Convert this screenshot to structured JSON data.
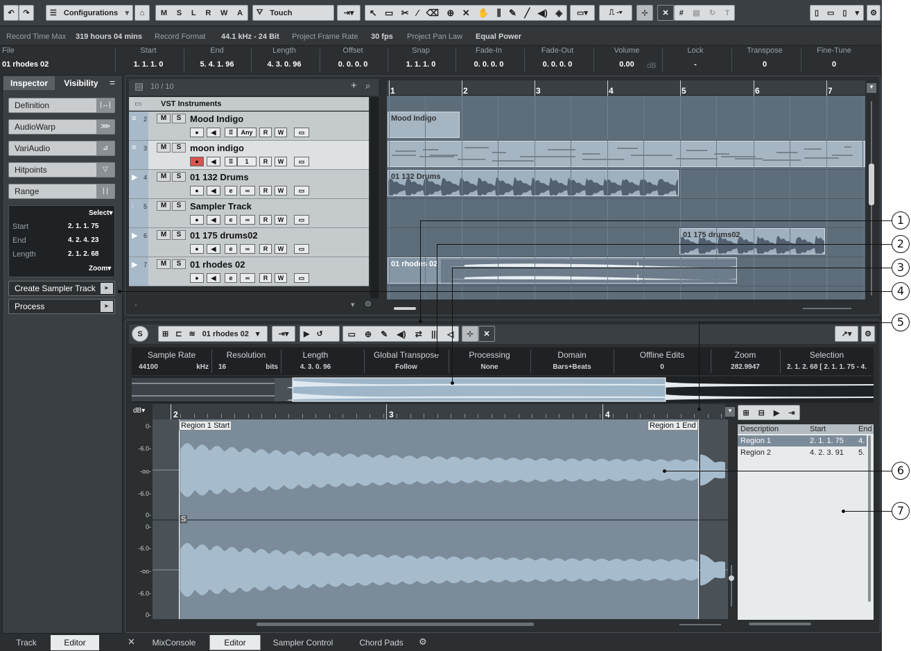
{
  "toolbar": {
    "configurations": "Configurations",
    "automation_mode": "Touch",
    "msrwa": [
      "M",
      "S",
      "L",
      "R",
      "W",
      "A"
    ]
  },
  "status": {
    "record_time_label": "Record Time Max",
    "record_time_value": "319 hours 04 mins",
    "record_format_label": "Record Format",
    "record_format_value": "44.1 kHz - 24 Bit",
    "frame_rate_label": "Project Frame Rate",
    "frame_rate_value": "30 fps",
    "pan_law_label": "Project Pan Law",
    "pan_law_value": "Equal Power"
  },
  "infoline": {
    "file_label": "File",
    "file_value": "01 rhodes 02",
    "cols": [
      {
        "h": "Start",
        "v": "1. 1. 1.   0"
      },
      {
        "h": "End",
        "v": "5. 4. 1. 96"
      },
      {
        "h": "Length",
        "v": "4. 3. 0. 96"
      },
      {
        "h": "Offset",
        "v": "0. 0. 0.   0"
      },
      {
        "h": "Snap",
        "v": "1. 1. 1.   0"
      },
      {
        "h": "Fade-In",
        "v": "0. 0. 0.   0"
      },
      {
        "h": "Fade-Out",
        "v": "0. 0. 0.   0"
      },
      {
        "h": "Volume",
        "v": "0.00"
      },
      {
        "h": "Lock",
        "v": "-"
      },
      {
        "h": "Transpose",
        "v": "0"
      },
      {
        "h": "Fine-Tune",
        "v": "0"
      }
    ],
    "volume_unit": "dB"
  },
  "inspector": {
    "tabs": [
      "Inspector",
      "Visibility"
    ],
    "buttons": [
      "Definition",
      "AudioWarp",
      "VariAudio",
      "Hitpoints",
      "Range"
    ],
    "select_label": "Select",
    "zoom_label": "Zoom",
    "range_rows": [
      {
        "k": "Start",
        "v": "2. 1. 1. 75"
      },
      {
        "k": "End",
        "v": "4. 2. 4. 23"
      },
      {
        "k": "Length",
        "v": "2. 1. 2. 68"
      }
    ],
    "create_sampler": "Create Sampler Track",
    "process": "Process",
    "bottom_tabs": [
      "Track",
      "Editor"
    ]
  },
  "project": {
    "track_count": "10 / 10",
    "folder_name": "VST Instruments",
    "tracks": [
      {
        "num": "2",
        "name": "Mood Indigo",
        "ctl": "Any"
      },
      {
        "num": "3",
        "name": "moon indigo",
        "ctl": "1"
      },
      {
        "num": "4",
        "name": "01 132 Drums"
      },
      {
        "num": "5",
        "name": "Sampler Track"
      },
      {
        "num": "6",
        "name": "01 175 drums02"
      },
      {
        "num": "7",
        "name": "01 rhodes 02"
      }
    ],
    "ruler": [
      "1",
      "2",
      "3",
      "4",
      "5",
      "6",
      "7"
    ],
    "clips": [
      "Mood Indigo",
      "01 132 Drums",
      "01 175 drums02",
      "01 rhodes 02"
    ]
  },
  "editor": {
    "file_select": "01 rhodes 02",
    "info": [
      {
        "h": "Sample Rate",
        "v": "44100",
        "u": "kHz"
      },
      {
        "h": "Resolution",
        "v": "16",
        "u": "bits"
      },
      {
        "h": "Length",
        "v": "4. 3. 0. 96"
      },
      {
        "h": "Global Transpose",
        "v": "Follow"
      },
      {
        "h": "Processing",
        "v": "None"
      },
      {
        "h": "Domain",
        "v": "Bars+Beats"
      },
      {
        "h": "Offline Edits",
        "v": "0"
      },
      {
        "h": "Zoom",
        "v": "282.9947"
      },
      {
        "h": "Selection",
        "v": "2. 1. 2. 68 [ 2. 1. 1. 75 - 4."
      }
    ],
    "ruler": [
      "2",
      "3",
      "4"
    ],
    "db_unit": "dB",
    "db_labels": [
      "0-",
      "-6.0-",
      "-oo-",
      "-6.0-",
      "0-"
    ],
    "region_start": "Region 1 Start",
    "region_end": "Region 1 End",
    "s_marker": "S",
    "regions_header": [
      "Description",
      "Start",
      "End"
    ],
    "regions": [
      {
        "d": "Region 1",
        "s": "2. 1. 1. 75",
        "e": "4."
      },
      {
        "d": "Region 2",
        "s": "4. 2. 3. 91",
        "e": "5."
      }
    ]
  },
  "bottom_tabs": [
    "MixConsole",
    "Editor",
    "Sampler Control",
    "Chord Pads"
  ],
  "callouts": [
    "1",
    "2",
    "3",
    "4",
    "5",
    "6",
    "7"
  ],
  "colors": {
    "panel": "#2b2f32",
    "track_bg": "#c5cacd",
    "clip": "#9fb0bf",
    "waveform": "#a6bccd",
    "selection": "#7b8b99"
  }
}
